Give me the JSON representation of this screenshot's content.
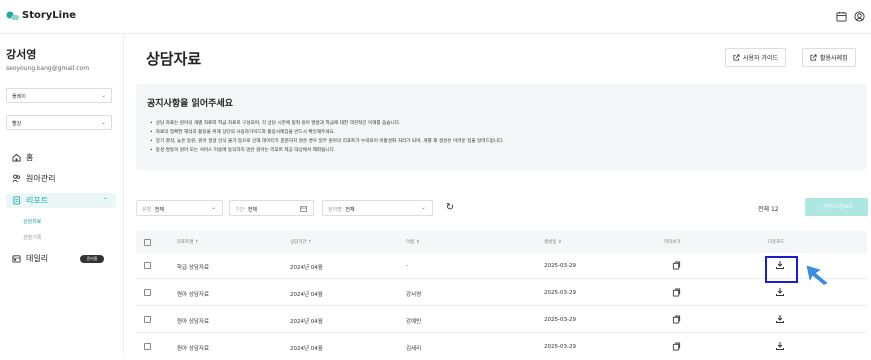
{
  "app": {
    "logo_text": "StoryLine",
    "brand_color": "#1eaaa1"
  },
  "user": {
    "name": "강서영",
    "email": "seoyoung.kang@gmail.com"
  },
  "sidebar": {
    "select1": "플레이",
    "select2": "빨강",
    "nav": {
      "home": "홈",
      "children": "원아관리",
      "report": "리포트",
      "daily": "데일리"
    },
    "sub": {
      "consult": "상담자료",
      "observe": "관찰기록"
    },
    "daily_badge": "준비중"
  },
  "header": {
    "title": "상담자료",
    "guide_btn": "사용자 가이드",
    "usecase_btn": "활용사례집"
  },
  "notice": {
    "title": "공지사항을 읽어주세요",
    "items": [
      "상담 자료는 원아의 개별 자료와 학급 자료로 구성되며, 각 상담 시즌에 맞춰 원아 발달과 학급에 대한 객관적인 이해를 돕습니다.",
      "자료의 정확한 해석과 활용을 위해 상단의 사용자가이드와 활용사례집을 반드시 확인해주세요.",
      "장기 결석, 늦은 등원, 원아 얼굴 인식 불가 등으로 인해 데이터가 충분하지 않은 경우 일부 원아의 리포트가 누락되어 비활성화 처리가 되며, 개별 재 생성은 어려운 점을 알려드립니다.",
      "동성 쌍둥이 원아 또는 서비스 이용에 동의하지 않은 원아는 리포트 제공 대상에서 제외됩니다."
    ]
  },
  "filters": {
    "type_label": "유형",
    "type_value": "전체",
    "period_label": "기간",
    "period_value": "전체",
    "child_label": "원아명",
    "child_value": "전체",
    "total": "전체 12",
    "download_selected": "선택 다운로드"
  },
  "table": {
    "headers": {
      "type": "리포트명",
      "period": "상담기간",
      "name": "이름",
      "created": "생성일",
      "preview": "미리보기",
      "download": "다운로드"
    },
    "rows": [
      {
        "type": "학급 상담자료",
        "period": "2024년 04월",
        "name": "-",
        "created": "2025-03-29"
      },
      {
        "type": "원아 상담자료",
        "period": "2024년 04월",
        "name": "강서영",
        "created": "2025-03-29"
      },
      {
        "type": "원아 상담자료",
        "period": "2024년 04월",
        "name": "강예빈",
        "created": "2025-03-29"
      },
      {
        "type": "원아 상담자료",
        "period": "2024년 04월",
        "name": "김세리",
        "created": "2025-03-29"
      }
    ]
  }
}
